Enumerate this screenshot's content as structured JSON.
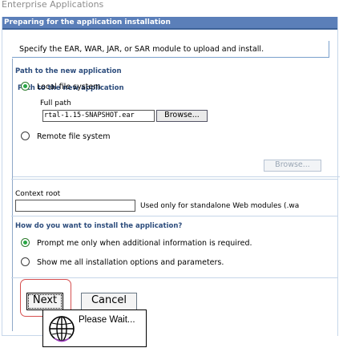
{
  "app": {
    "title": "Enterprise Applications"
  },
  "panel": {
    "header": "Preparing for the application installation",
    "instructions": "Specify the EAR, WAR, JAR, or SAR module to upload and install."
  },
  "path_section": {
    "header": "Path to the new application",
    "local_label": "Local file system",
    "full_path_label": "Full path",
    "full_path_value": "rtal-1.15-SNAPSHOT.ear",
    "browse_label": "Browse...",
    "remote_label": "Remote file system",
    "remote_browse_label": "Browse...",
    "local_selected": true
  },
  "context_root": {
    "label": "Context root",
    "value": "",
    "hint": "Used only for standalone Web modules (.wa"
  },
  "install_section": {
    "header": "How do you want to install the application?",
    "prompt_label": "Prompt me only when additional information is required.",
    "show_all_label": "Show me all installation options and parameters."
  },
  "buttons": {
    "next": "Next",
    "cancel": "Cancel"
  },
  "wait_popup": {
    "text": "Please Wait..."
  },
  "colors": {
    "header_bg": "#5b7fb9",
    "section_header": "#2c4c7c",
    "radio_checked": "#28a745",
    "highlight": "#d65050"
  }
}
